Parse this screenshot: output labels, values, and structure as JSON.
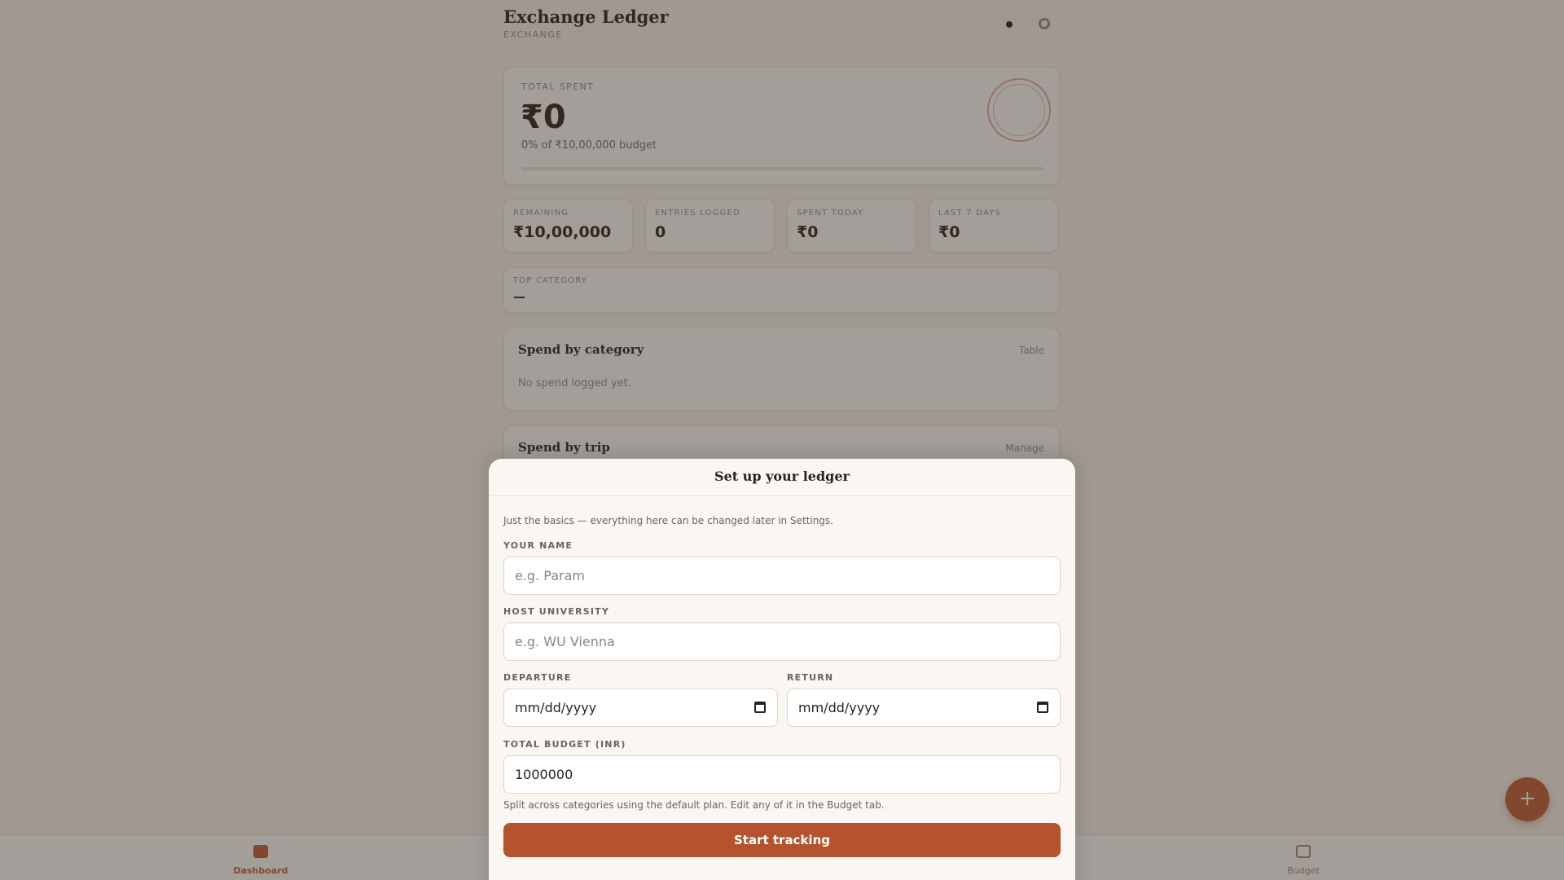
{
  "header": {
    "title": "Exchange Ledger",
    "subtitle": "EXCHANGE"
  },
  "hero": {
    "label": "TOTAL SPENT",
    "amount": "₹0",
    "percent_text": "0% of ₹10,00,000 budget",
    "progress": 0,
    "stamp": {
      "line1": "",
      "line2": "",
      "line3": ""
    }
  },
  "stats": [
    {
      "label": "REMAINING",
      "value": "₹10,00,000"
    },
    {
      "label": "ENTRIES LOGGED",
      "value": "0"
    },
    {
      "label": "SPENT TODAY",
      "value": "₹0"
    },
    {
      "label": "LAST 7 DAYS",
      "value": "₹0"
    }
  ],
  "top_category": {
    "label": "TOP CATEGORY",
    "value": "—"
  },
  "sections": [
    {
      "title": "Spend by category",
      "action": "Table",
      "empty": "No spend logged yet."
    },
    {
      "title": "Spend by trip",
      "action": "Manage"
    }
  ],
  "nav": {
    "dashboard": "Dashboard",
    "budget": "Budget"
  },
  "fab": "+",
  "colors": {
    "accent": "#c35b3a",
    "primary_button": "#b5532f",
    "background": "#faf6f1"
  },
  "icons": {
    "header_dot": "theme-dot-icon",
    "header_settings": "gear-icon",
    "dashboard": "dashboard-icon",
    "budget": "wallet-icon",
    "fab": "plus-icon"
  },
  "modal": {
    "title": "Set up your ledger",
    "intro": "Just the basics — everything here can be changed later in Settings.",
    "name_label": "YOUR NAME",
    "name_placeholder": "e.g. Param",
    "university_label": "HOST UNIVERSITY",
    "university_placeholder": "e.g. WU Vienna",
    "departure_label": "DEPARTURE",
    "departure_value": "mm/dd/yyyy",
    "return_label": "RETURN",
    "return_value": "mm/dd/yyyy",
    "budget_label": "TOTAL BUDGET (INR)",
    "budget_value": "1000000",
    "hint": "Split across categories using the default plan. Edit any of it in the Budget tab.",
    "submit": "Start tracking"
  }
}
